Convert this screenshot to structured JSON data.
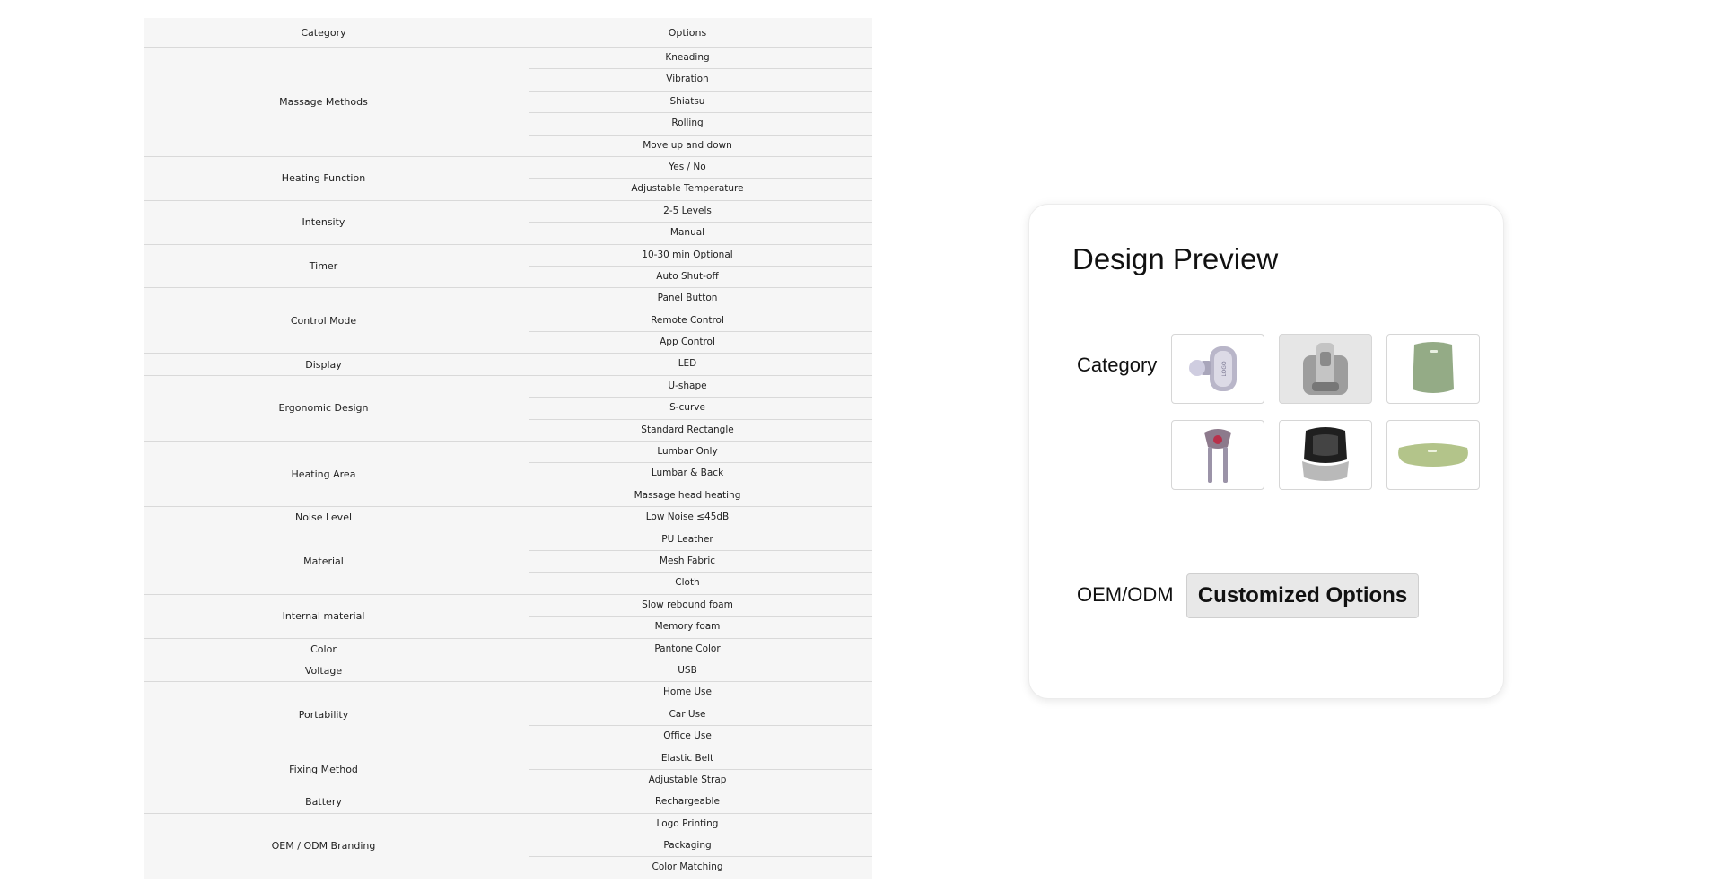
{
  "spec_table": {
    "header": {
      "category": "Category",
      "options": "Options"
    },
    "rows": [
      {
        "name": "Massage Methods",
        "options": [
          "Kneading",
          "Vibration",
          "Shiatsu",
          "Rolling",
          "Move up and down"
        ]
      },
      {
        "name": "Heating Function",
        "options": [
          "Yes / No",
          "Adjustable Temperature"
        ]
      },
      {
        "name": "Intensity",
        "options": [
          "2-5 Levels",
          "Manual"
        ]
      },
      {
        "name": "Timer",
        "options": [
          "10-30 min Optional",
          "Auto Shut-off"
        ]
      },
      {
        "name": "Control Mode",
        "options": [
          "Panel Button",
          "Remote Control",
          "App Control"
        ]
      },
      {
        "name": "Display",
        "options": [
          "LED"
        ]
      },
      {
        "name": "Ergonomic Design",
        "options": [
          "U-shape",
          "S-curve",
          "Standard Rectangle"
        ]
      },
      {
        "name": "Heating Area",
        "options": [
          "Lumbar Only",
          "Lumbar & Back",
          "Massage head heating"
        ]
      },
      {
        "name": "Noise Level",
        "options": [
          "Low Noise ≤45dB"
        ]
      },
      {
        "name": "Material",
        "options": [
          "PU Leather",
          "Mesh Fabric",
          "Cloth"
        ]
      },
      {
        "name": "Internal material",
        "options": [
          "Slow rebound foam",
          "Memory foam"
        ]
      },
      {
        "name": "Color",
        "options": [
          "Pantone Color"
        ]
      },
      {
        "name": "Voltage",
        "options": [
          "USB"
        ]
      },
      {
        "name": "Portability",
        "options": [
          "Home Use",
          "Car Use",
          "Office Use"
        ]
      },
      {
        "name": "Fixing Method",
        "options": [
          "Elastic Belt",
          "Adjustable Strap"
        ]
      },
      {
        "name": "Battery",
        "options": [
          "Rechargeable"
        ]
      },
      {
        "name": "OEM / ODM Branding",
        "options": [
          "Logo Printing",
          "Packaging",
          "Color Matching"
        ]
      }
    ]
  },
  "design_preview": {
    "title": "Design Preview",
    "category_label": "Category",
    "thumbnails": [
      {
        "icon": "massage-gun-icon",
        "selected": false
      },
      {
        "icon": "lumbar-massager-icon",
        "selected": true
      },
      {
        "icon": "back-pad-icon",
        "selected": false
      },
      {
        "icon": "neck-shoulder-massager-icon",
        "selected": false
      },
      {
        "icon": "foot-massager-icon",
        "selected": false
      },
      {
        "icon": "pillow-pad-icon",
        "selected": false
      }
    ],
    "oem_label": "OEM/ODM",
    "custom_button_label": "Customized Options"
  },
  "colors": {
    "table_bg": "#f6f6f6",
    "divider": "#d9d9d9",
    "selected_thumb": "#e6e6e6",
    "button_bg": "#e8e8e8"
  }
}
